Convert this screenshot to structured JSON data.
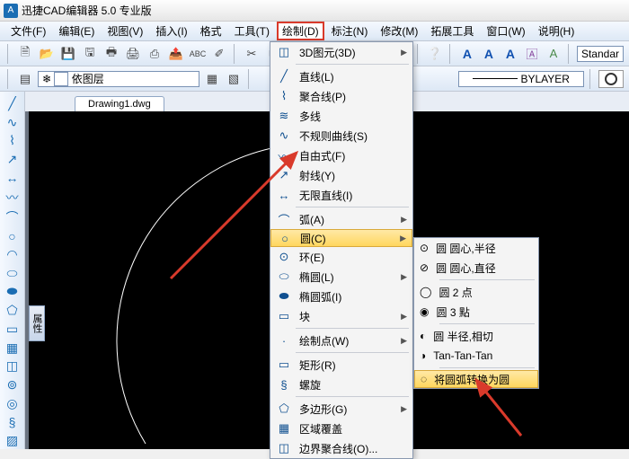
{
  "app": {
    "icon_text": "A",
    "title": "迅捷CAD编辑器 5.0 专业版"
  },
  "menubar": [
    "文件(F)",
    "编辑(E)",
    "视图(V)",
    "插入(I)",
    "格式",
    "工具(T)",
    "绘制(D)",
    "标注(N)",
    "修改(M)",
    "拓展工具",
    "窗口(W)",
    "说明(H)"
  ],
  "menubar_highlight_index": 6,
  "toolbar2": {
    "layer_label": "依图层",
    "bylayer": "BYLAYER",
    "style": "Standar"
  },
  "tabs": {
    "active": "Drawing1.dwg"
  },
  "attr_tab": "属性",
  "draw_menu": {
    "group1": [
      {
        "icon": "◫",
        "label": "3D图元(3D)",
        "sub": true
      }
    ],
    "group2": [
      {
        "icon": "╱",
        "label": "直线(L)"
      },
      {
        "icon": "⌇",
        "label": "聚合线(P)"
      },
      {
        "icon": "≋",
        "label": "多线"
      },
      {
        "icon": "∿",
        "label": "不规则曲线(S)"
      },
      {
        "icon": "〰",
        "label": "自由式(F)"
      },
      {
        "icon": "↗",
        "label": "射线(Y)"
      },
      {
        "icon": "↔",
        "label": "无限直线(I)"
      }
    ],
    "group3": [
      {
        "icon": "⌒",
        "label": "弧(A)",
        "sub": true
      },
      {
        "icon": "○",
        "label": "圆(C)",
        "sub": true,
        "hl": true
      },
      {
        "icon": "⊙",
        "label": "环(E)"
      },
      {
        "icon": "⬭",
        "label": "椭圆(L)",
        "sub": true
      },
      {
        "icon": "⬬",
        "label": "椭圆弧(I)"
      },
      {
        "icon": "▭",
        "label": "块",
        "sub": true
      }
    ],
    "group4": [
      {
        "icon": "·",
        "label": "绘制点(W)",
        "sub": true
      }
    ],
    "group5": [
      {
        "icon": "▭",
        "label": "矩形(R)"
      },
      {
        "icon": "§",
        "label": "螺旋"
      }
    ],
    "group6": [
      {
        "icon": "⬠",
        "label": "多边形(G)",
        "sub": true
      },
      {
        "icon": "▦",
        "label": "区域覆盖"
      },
      {
        "icon": "◫",
        "label": "边界聚合线(O)..."
      }
    ]
  },
  "circle_submenu": {
    "group1": [
      {
        "icon": "⊙",
        "label": "圆 圆心,半径"
      },
      {
        "icon": "⊘",
        "label": "圆 圆心,直径"
      }
    ],
    "group2": [
      {
        "icon": "◯",
        "label": "圆 2 点"
      },
      {
        "icon": "◉",
        "label": "圆 3 點"
      }
    ],
    "group3": [
      {
        "icon": "◐",
        "label": "圆 半径,相切"
      },
      {
        "icon": "◑",
        "label": "Tan-Tan-Tan"
      }
    ],
    "group4": [
      {
        "icon": "◌",
        "label": "将圆弧转换为圆",
        "hl": true
      }
    ]
  }
}
